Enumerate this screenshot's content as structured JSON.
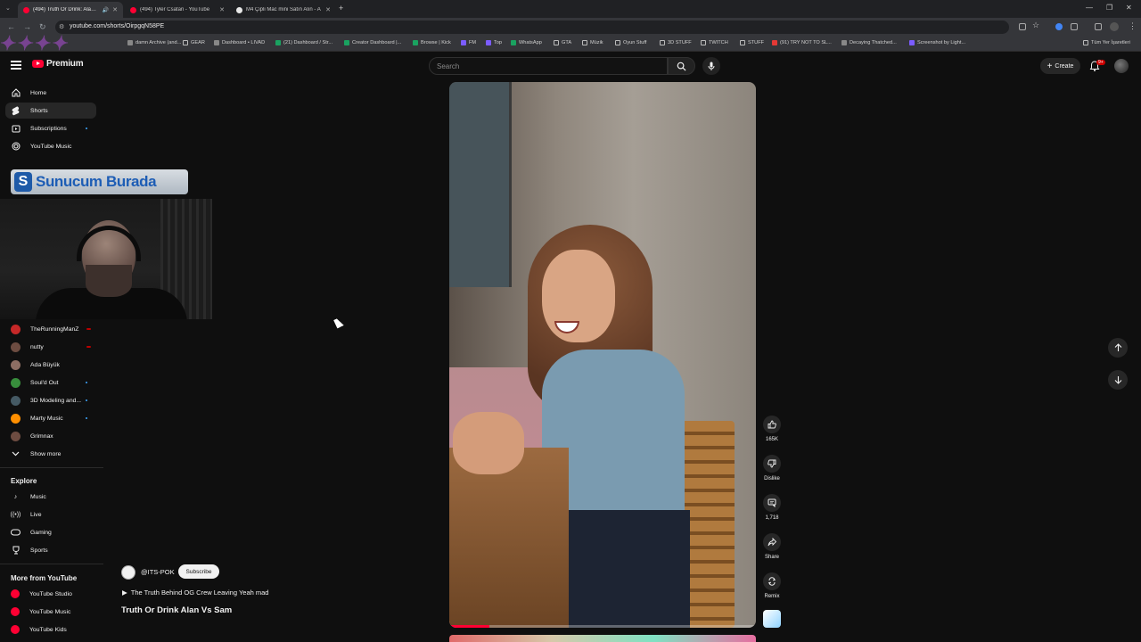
{
  "browser": {
    "tabs": [
      {
        "title": "(494) Truth Or Drink: Alan V"
      },
      {
        "title": "(494) Tyler Csatari - YouTube"
      },
      {
        "title": "M4 Çipli Mac mini Satın Alın - A"
      }
    ],
    "url": "youtube.com/shorts/OirpgqN58PE",
    "bookmarks": [
      "damn Archive (and...",
      "GEAR",
      "Dashboard • LIVAD",
      "(21) Dashboard / Str...",
      "Creator Dashboard |...",
      "Browse | Kick",
      "FM",
      "Top",
      "WhatsApp",
      "GTA",
      "Müzik",
      "Oyun Stuff",
      "3D STUFF",
      "TWITCH",
      "STUFF",
      "(91) TRY NOT TO SL...",
      "Decaying Thatched...",
      "Screenshot by Light..."
    ],
    "all_bookmarks": "Tüm Yer İşaretleri"
  },
  "youtube": {
    "logo_text": "Premium",
    "search_placeholder": "Search",
    "create_label": "Create",
    "notif_badge": "9+",
    "nav": [
      {
        "label": "Home",
        "icon": "home-icon"
      },
      {
        "label": "Shorts",
        "icon": "shorts-icon"
      },
      {
        "label": "Subscriptions",
        "icon": "subscriptions-icon"
      },
      {
        "label": "YouTube Music",
        "icon": "music-icon"
      }
    ],
    "subscriptions": [
      {
        "label": "TheRunningManZ",
        "color": "#c62828"
      },
      {
        "label": "nutty",
        "color": "#6d4c41"
      },
      {
        "label": "Ada Büyük",
        "color": "#8d6e63"
      },
      {
        "label": "Soul'd Out",
        "color": "#388e3c"
      },
      {
        "label": "3D Modeling and...",
        "color": "#455a64"
      },
      {
        "label": "Marty Music",
        "color": "#ff8f00"
      },
      {
        "label": "Grimnax",
        "color": "#6d4c41"
      }
    ],
    "show_more": "Show more",
    "explore_title": "Explore",
    "explore": [
      "Music",
      "Live",
      "Gaming",
      "Sports"
    ],
    "more_title": "More from YouTube",
    "more": [
      "YouTube Studio",
      "YouTube Music",
      "YouTube Kids"
    ]
  },
  "overlay": {
    "sunucum_text": "Sunucum Burada",
    "sunucum_logo": "S"
  },
  "short": {
    "channel": "@ITS-POK",
    "subscribe_label": "Subscribe",
    "track": "The Truth Behind OG Crew Leaving Yeah mad",
    "title": "Truth Or Drink Alan Vs Sam",
    "progress": 0.13,
    "likes": "165K",
    "dislike_label": "Dislike",
    "comments": "1,718",
    "share_label": "Share",
    "remix_label": "Remix"
  },
  "colors": {
    "brand_red": "#ff0033",
    "accent_blue": "#3ea6ff"
  }
}
